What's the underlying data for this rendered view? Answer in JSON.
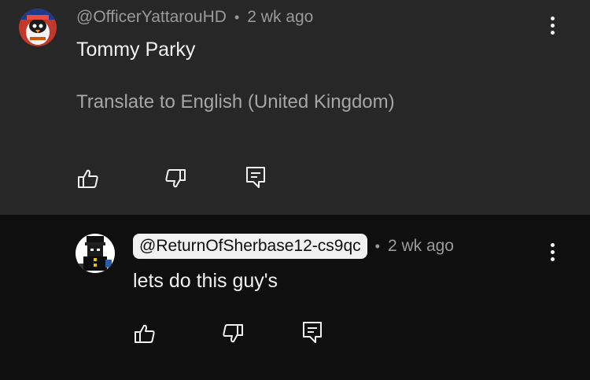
{
  "comments": [
    {
      "author": "@OfficerYattarouHD",
      "age": "2 wk ago",
      "text": "Tommy Parky",
      "translate_label": "Translate to English (United Kingdom)",
      "avatar_icon": "penguin-avatar-icon"
    }
  ],
  "reply": {
    "author": "@ReturnOfSherbase12-cs9qc",
    "age": "2 wk ago",
    "text": "lets do this guy's",
    "avatar_icon": "blocky-character-avatar-icon"
  },
  "separator": "•",
  "icons": {
    "like": "thumbs-up-icon",
    "dislike": "thumbs-down-icon",
    "reply": "reply-comment-icon",
    "more": "more-vertical-icon"
  },
  "colors": {
    "top_background": "#272727",
    "reply_background": "#0f0f0f",
    "secondary_text": "#9a9a9a",
    "badge_background": "#f1f1f1"
  }
}
